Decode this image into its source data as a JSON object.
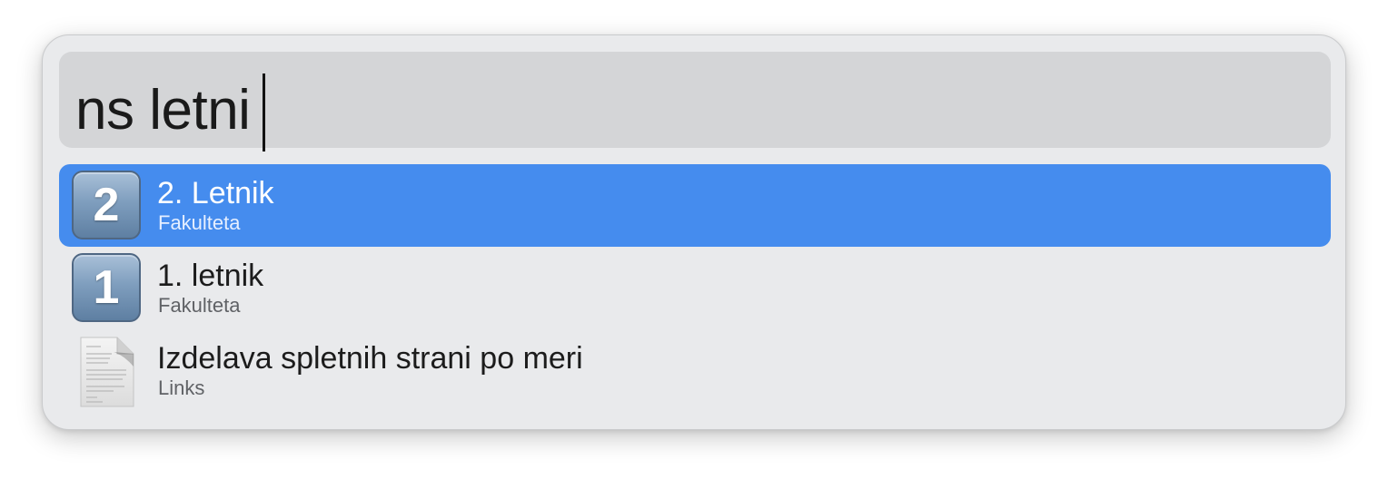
{
  "search": {
    "query": "ns letni"
  },
  "results": [
    {
      "title": "2. Letnik",
      "subtitle": "Fakulteta",
      "icon": "number-2-icon",
      "icon_glyph": "2",
      "selected": true
    },
    {
      "title": "1. letnik",
      "subtitle": "Fakulteta",
      "icon": "number-1-icon",
      "icon_glyph": "1",
      "selected": false
    },
    {
      "title": "Izdelava spletnih strani po meri",
      "subtitle": "Links",
      "icon": "document-icon",
      "selected": false
    }
  ],
  "colors": {
    "panel_background": "#e9eaec",
    "search_background": "#d4d5d7",
    "selection_accent": "#458cee"
  }
}
